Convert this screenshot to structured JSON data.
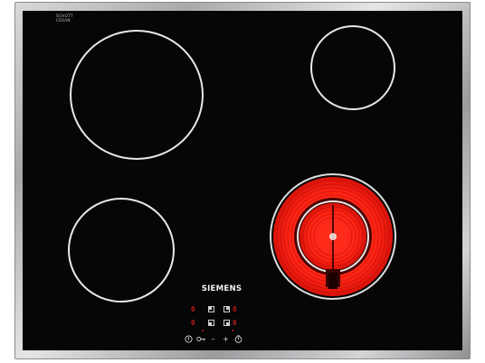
{
  "brand": {
    "name": "SIEMENS",
    "glass_maker": [
      "SCHOTT",
      "CERAN"
    ],
    "glass_code": ""
  },
  "zones": [
    {
      "name": "rear-left",
      "state": "off"
    },
    {
      "name": "rear-right",
      "state": "off"
    },
    {
      "name": "front-left",
      "state": "off"
    },
    {
      "name": "front-right",
      "state": "on",
      "type": "dual-circuit"
    }
  ],
  "displays": [
    "0",
    "0",
    "0",
    "0"
  ],
  "controls": {
    "power_icon": "power-icon",
    "lock_icon": "key-lock-icon",
    "minus_label": "–",
    "plus_label": "+",
    "timer_icon": "timer-icon"
  },
  "colors": {
    "glass": "#060606",
    "frame": "#a7a9ab",
    "heat": "#ff2a1a",
    "display": "#c11c1c"
  }
}
